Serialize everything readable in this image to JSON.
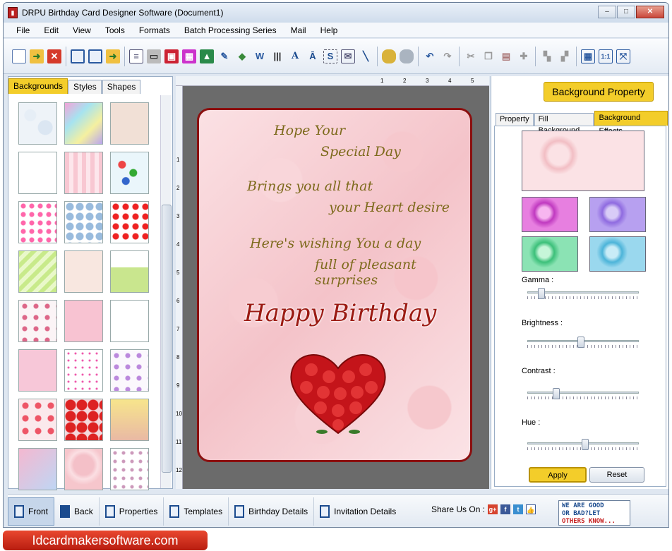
{
  "window": {
    "title": "DRPU Birthday Card Designer Software (Document1)"
  },
  "menu": [
    "File",
    "Edit",
    "View",
    "Tools",
    "Formats",
    "Batch Processing Series",
    "Mail",
    "Help"
  ],
  "left_panel": {
    "tabs": [
      "Backgrounds",
      "Styles",
      "Shapes"
    ],
    "active_tab": "Backgrounds"
  },
  "card": {
    "lines": [
      "Hope Your",
      "Special Day",
      "Brings you all that",
      "your Heart desire",
      "Here's wishing You a day",
      "full of pleasant surprises"
    ],
    "headline": "Happy Birthday"
  },
  "right_panel": {
    "title_button": "Background Property",
    "tabs": [
      "Property",
      "Fill Background",
      "Background Effects"
    ],
    "active_tab": "Background Effects",
    "sliders": [
      {
        "label": "Gamma :",
        "value": 0.1
      },
      {
        "label": "Brightness :",
        "value": 0.48
      },
      {
        "label": "Contrast :",
        "value": 0.24
      },
      {
        "label": "Hue :",
        "value": 0.52
      }
    ],
    "apply_label": "Apply",
    "reset_label": "Reset"
  },
  "bottom_bar": {
    "items": [
      "Front",
      "Back",
      "Properties",
      "Templates",
      "Birthday Details",
      "Invitation Details"
    ],
    "share_label": "Share Us On :",
    "feedback": [
      "WE ARE GOOD",
      "OR BAD?LET",
      "OTHERS KNOW..."
    ]
  },
  "brand": "Idcardmakersoftware.com",
  "ruler_top": [
    "1",
    "2",
    "3",
    "4",
    "5"
  ],
  "ruler_left": [
    "1",
    "2",
    "3",
    "4",
    "5",
    "6",
    "7",
    "8",
    "9",
    "10",
    "11",
    "12"
  ]
}
